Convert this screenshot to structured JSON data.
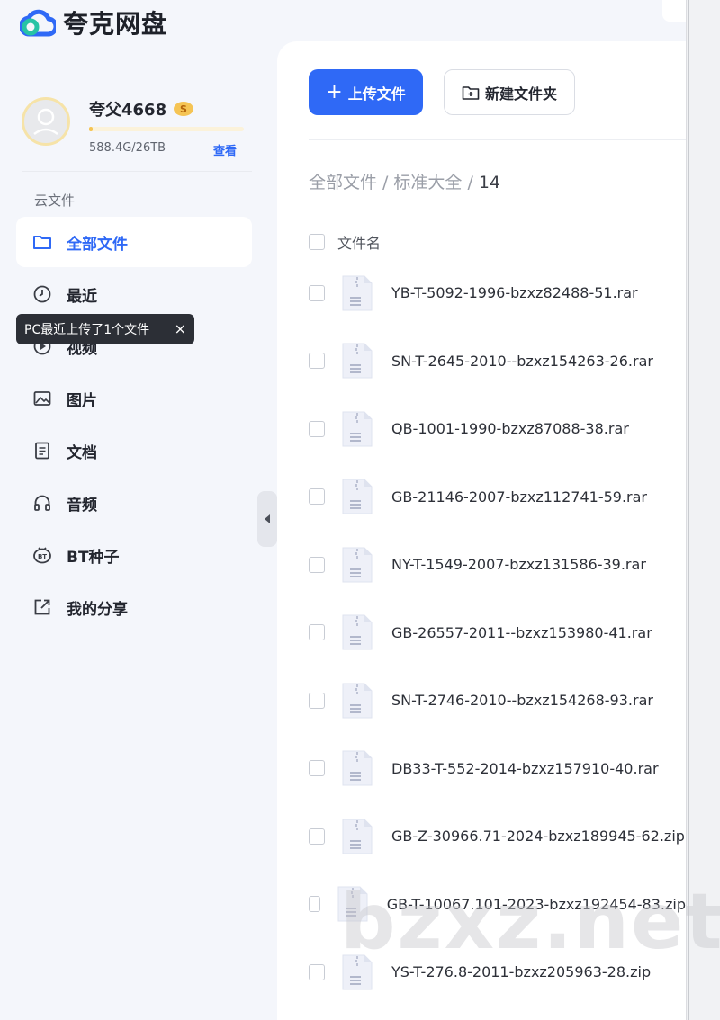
{
  "app": {
    "name": "夸克网盘"
  },
  "user": {
    "name": "夸父4668",
    "usage": "588.4G/26TB",
    "usage_fraction": 0.022,
    "view_label": "查看"
  },
  "sidebar": {
    "section_label": "云文件",
    "items": [
      {
        "label": "全部文件",
        "icon": "folder-icon",
        "active": true
      },
      {
        "label": "最近",
        "icon": "clock-icon",
        "active": false
      },
      {
        "label": "视频",
        "icon": "play-icon",
        "active": false
      },
      {
        "label": "图片",
        "icon": "image-icon",
        "active": false
      },
      {
        "label": "文档",
        "icon": "document-icon",
        "active": false
      },
      {
        "label": "音频",
        "icon": "headphones-icon",
        "active": false
      },
      {
        "label": "BT种子",
        "icon": "bt-icon",
        "active": false
      },
      {
        "label": "我的分享",
        "icon": "share-icon",
        "active": false
      }
    ]
  },
  "tooltip": {
    "text": "PC最近上传了1个文件",
    "close": "×"
  },
  "toolbar": {
    "upload_label": "上传文件",
    "new_folder_label": "新建文件夹"
  },
  "breadcrumb": {
    "root": "全部文件",
    "parent": "标准大全",
    "current": "14",
    "sep": "/"
  },
  "file_list": {
    "header": "文件名",
    "files": [
      "YB-T-5092-1996-bzxz82488-51.rar",
      "SN-T-2645-2010--bzxz154263-26.rar",
      "QB-1001-1990-bzxz87088-38.rar",
      "GB-21146-2007-bzxz112741-59.rar",
      "NY-T-1549-2007-bzxz131586-39.rar",
      "GB-26557-2011--bzxz153980-41.rar",
      "SN-T-2746-2010--bzxz154268-93.rar",
      "DB33-T-552-2014-bzxz157910-40.rar",
      "GB-Z-30966.71-2024-bzxz189945-62.zip",
      "GB-T-10067.101-2023-bzxz192454-83.zip",
      "YS-T-276.8-2011-bzxz205963-28.zip"
    ]
  },
  "watermark": "bzxz.net",
  "colors": {
    "accent": "#2f69f6",
    "tooltip_bg": "#2c2f36",
    "usage": "#f5c454"
  }
}
